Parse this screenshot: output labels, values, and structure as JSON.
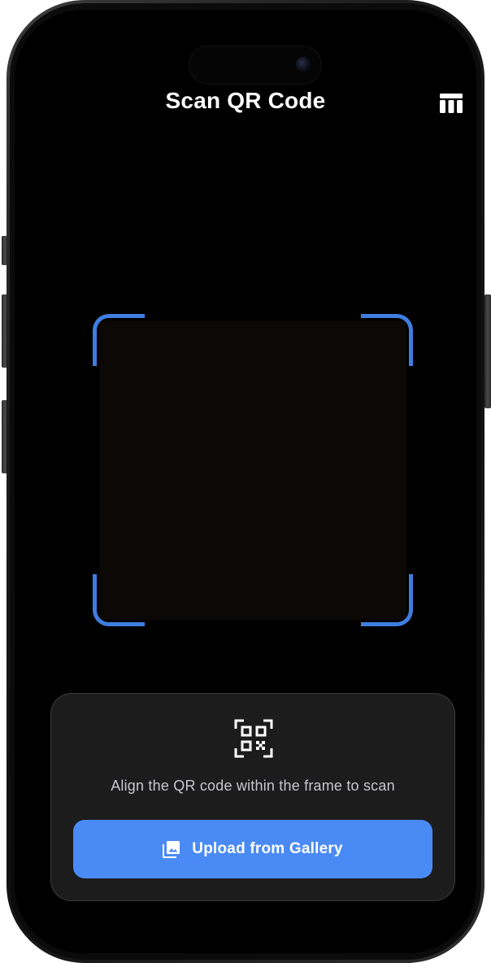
{
  "header": {
    "title": "Scan QR Code",
    "right_icon": "view-columns-icon"
  },
  "scanner": {
    "frame_color": "#3f7ee0"
  },
  "panel": {
    "icon": "qr-code-scan-icon",
    "instruction": "Align the QR code within the frame to scan",
    "upload_button": {
      "label": "Upload from Gallery",
      "icon": "photo-library-icon",
      "color": "#4a8af4"
    }
  }
}
